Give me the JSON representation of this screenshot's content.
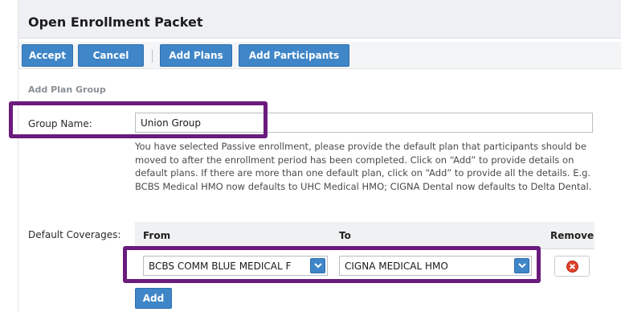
{
  "header": {
    "title": "Open Enrollment Packet"
  },
  "toolbar": {
    "accept_label": "Accept",
    "cancel_label": "Cancel",
    "separator": "|",
    "add_plans_label": "Add Plans",
    "add_participants_label": "Add Participants"
  },
  "section": {
    "title": "Add Plan Group"
  },
  "group_name": {
    "label": "Group Name:",
    "value": "Union Group"
  },
  "help_text": "You have selected Passive enrollment, please provide the default plan that participants should be moved to after the enrollment period has been completed. Click on “Add” to provide details on default plans. If there are more than one default plan, click on “Add” to provide all the details. E.g. BCBS Medical HMO now defaults to UHC Medical HMO; CIGNA Dental now defaults to Delta Dental.",
  "default_coverages": {
    "label": "Default Coverages:",
    "columns": {
      "from": "From",
      "to": "To",
      "remove": "Remove"
    },
    "rows": [
      {
        "from": "BCBS COMM BLUE MEDICAL F",
        "to": "CIGNA MEDICAL HMO"
      }
    ],
    "add_label": "Add"
  },
  "icons": {
    "dropdown": "chevron-down-icon",
    "remove": "remove-circle-icon"
  },
  "colors": {
    "button_blue": "#3f86c8",
    "highlight_purple": "#6a1b7c",
    "remove_red": "#e0412c"
  }
}
